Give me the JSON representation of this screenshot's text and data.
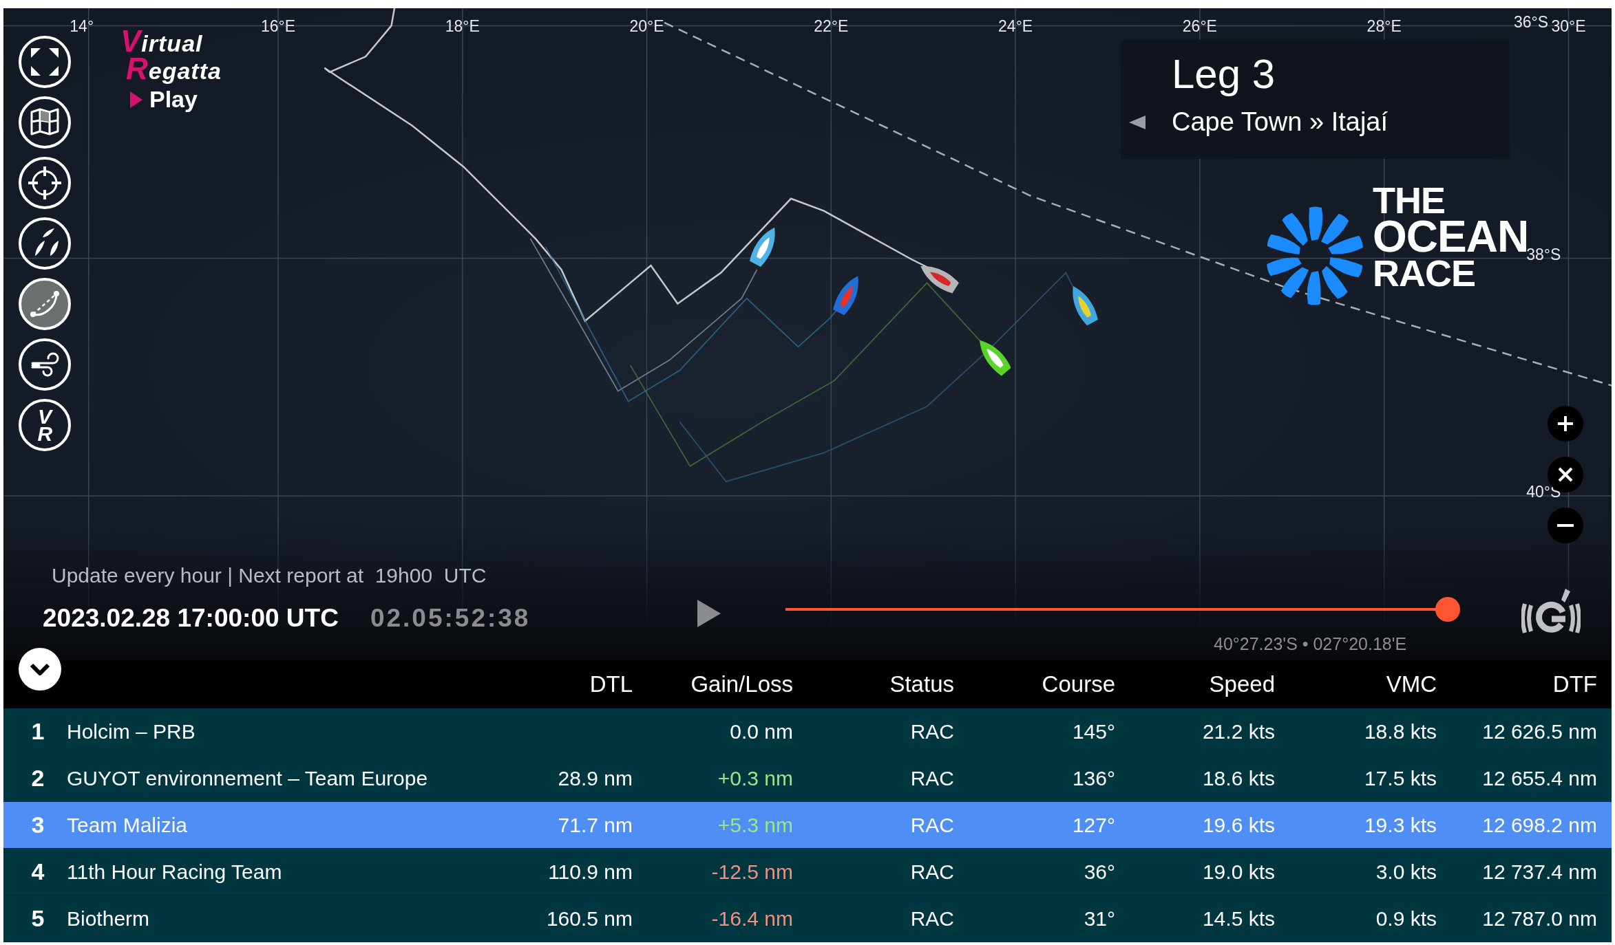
{
  "map": {
    "lon_labels": [
      "14°",
      "16°E",
      "18°E",
      "20°E",
      "22°E",
      "24°E",
      "26°E",
      "28°E",
      "30°E"
    ],
    "lat_labels": [
      "36°S",
      "38°S",
      "40°S"
    ],
    "boats": [
      {
        "color": "#4fb3e8"
      },
      {
        "color": "#1f6fd6"
      },
      {
        "color": "#b5b5b5"
      },
      {
        "color": "#5bd32b"
      },
      {
        "color": "#3fa8e0"
      }
    ]
  },
  "toolbar": [
    {
      "kind": "fullscreen",
      "selected": false
    },
    {
      "kind": "map",
      "selected": false
    },
    {
      "kind": "target",
      "selected": false
    },
    {
      "kind": "boats",
      "selected": false
    },
    {
      "kind": "route",
      "selected": true
    },
    {
      "kind": "wind",
      "selected": false
    },
    {
      "kind": "vr",
      "label": "VR",
      "selected": false
    }
  ],
  "brand": {
    "line1": "Virtual",
    "line2": "Regatta",
    "play": "Play"
  },
  "leg": {
    "title": "Leg 3",
    "route": "Cape Town » Itajaí"
  },
  "sponsor_logo": {
    "lines": [
      "THE",
      "OCEAN",
      "RACE"
    ]
  },
  "zoom_controls": [
    {
      "kind": "plus"
    },
    {
      "kind": "close"
    },
    {
      "kind": "minus"
    }
  ],
  "timeline": {
    "update_note": "Update every hour | Next report at  19h00  UTC",
    "datetime": "2023.02.28 17:00:00 UTC",
    "countdown": "02.05:52:38",
    "level": 1.0,
    "position": "40°27.23'S • 027°20.18'E"
  },
  "table": {
    "columns": [
      "DTL",
      "Gain/Loss",
      "Status",
      "Course",
      "Speed",
      "VMC",
      "DTF"
    ],
    "rows": [
      {
        "rank": "1",
        "name": "Holcim – PRB",
        "gain_loss": {
          "text": "0.0 nm",
          "color": "#ffffff"
        },
        "status": "RAC",
        "course": "145°",
        "speed": "21.2 kts",
        "vmc": "18.8 kts",
        "dtf": "12 626.5 nm",
        "selected": false
      },
      {
        "rank": "2",
        "name": "GUYOT environnement – Team Europe",
        "dtl": "28.9 nm",
        "gain_loss": {
          "text": "+0.3 nm",
          "color": "#9ce688"
        },
        "status": "RAC",
        "course": "136°",
        "speed": "18.6 kts",
        "vmc": "17.5 kts",
        "dtf": "12 655.4 nm",
        "selected": false
      },
      {
        "rank": "3",
        "name": "Team Malizia",
        "dtl": "71.7 nm",
        "gain_loss": {
          "text": "+5.3 nm",
          "color": "#9ce688"
        },
        "status": "RAC",
        "course": "127°",
        "speed": "19.6 kts",
        "vmc": "19.3 kts",
        "dtf": "12 698.2 nm",
        "selected": true
      },
      {
        "rank": "4",
        "name": "11th Hour Racing Team",
        "dtl": "110.9 nm",
        "gain_loss": {
          "text": "-12.5 nm",
          "color": "#f2907f"
        },
        "status": "RAC",
        "course": "36°",
        "speed": "19.0 kts",
        "vmc": "3.0 kts",
        "dtf": "12 737.4 nm",
        "selected": false
      },
      {
        "rank": "5",
        "name": "Biotherm",
        "dtl": "160.5 nm",
        "gain_loss": {
          "text": "-16.4 nm",
          "color": "#f2907f"
        },
        "status": "RAC",
        "course": "31°",
        "speed": "14.5 kts",
        "vmc": "0.9 kts",
        "dtf": "12 787.0 nm",
        "selected": false
      }
    ]
  }
}
